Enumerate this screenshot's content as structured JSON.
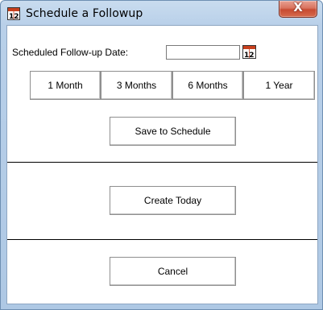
{
  "window": {
    "title": "Schedule a Followup",
    "close_label": "X"
  },
  "form": {
    "date_label": "Scheduled Follow-up Date:",
    "date_value": "",
    "date_placeholder": ""
  },
  "quick_buttons": [
    "1 Month",
    "3 Months",
    "6 Months",
    "1 Year"
  ],
  "actions": {
    "save": "Save to Schedule",
    "create_today": "Create Today",
    "cancel": "Cancel"
  },
  "icons": {
    "app": "calendar-icon",
    "date_picker": "calendar-icon",
    "close": "close-icon"
  },
  "colors": {
    "title_bar": "#b9d0e9",
    "close_button": "#c74b32",
    "calendar_accent": "#c8401e"
  }
}
